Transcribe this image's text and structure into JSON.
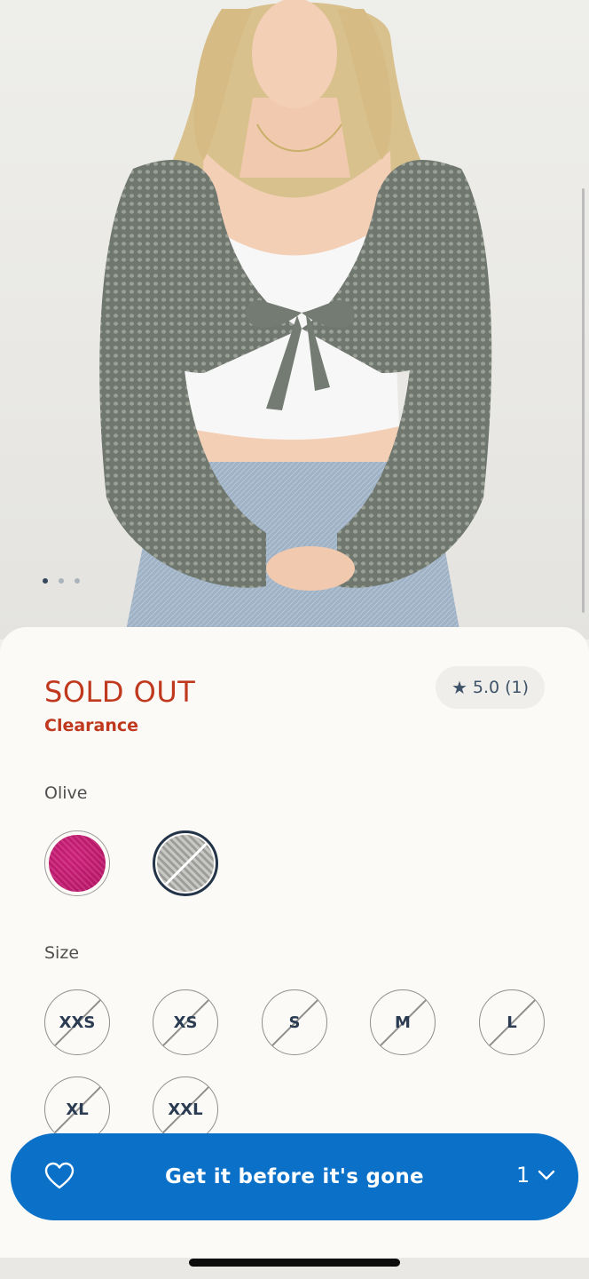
{
  "carousel": {
    "page_count": 3,
    "active_index": 0
  },
  "product": {
    "status": "SOLD OUT",
    "promo": "Clearance",
    "rating": {
      "score": "5.0",
      "count": "(1)",
      "icon": "star-icon"
    }
  },
  "color": {
    "label": "Olive",
    "swatches": [
      {
        "name": "pink",
        "hex": "#c01a6e",
        "available": true
      },
      {
        "name": "olive",
        "hex": "#a9aaa5",
        "available": false,
        "selected": true
      }
    ]
  },
  "size": {
    "label": "Size",
    "options": [
      "XXS",
      "XS",
      "S",
      "M",
      "L",
      "XL",
      "XXL"
    ]
  },
  "cta": {
    "label": "Get it before it's gone",
    "quantity": "1",
    "icons": [
      "heart-icon",
      "chevron-down-icon"
    ],
    "color": "#0a70c8"
  },
  "colors": {
    "accent": "#0a70c8",
    "sale": "#c0391f",
    "navy": "#233449"
  }
}
